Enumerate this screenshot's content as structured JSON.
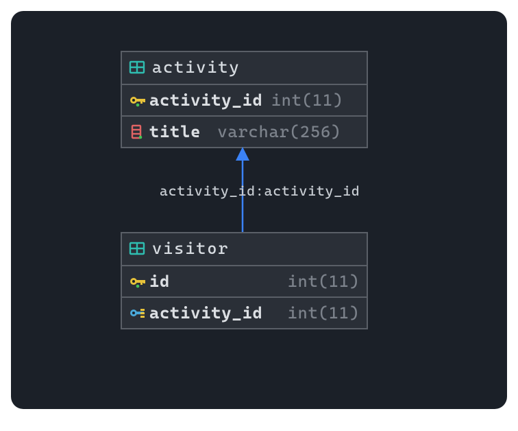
{
  "tables": {
    "activity": {
      "name": "activity",
      "columns": {
        "activity_id": {
          "name": "activity_id",
          "type": "int(11)"
        },
        "title": {
          "name": "title",
          "type": "varchar(256)"
        }
      }
    },
    "visitor": {
      "name": "visitor",
      "columns": {
        "id": {
          "name": "id",
          "type": "int(11)"
        },
        "activity_id": {
          "name": "activity_id",
          "type": "int(11)"
        }
      }
    }
  },
  "relationship": {
    "label": "activity_id:activity_id"
  }
}
